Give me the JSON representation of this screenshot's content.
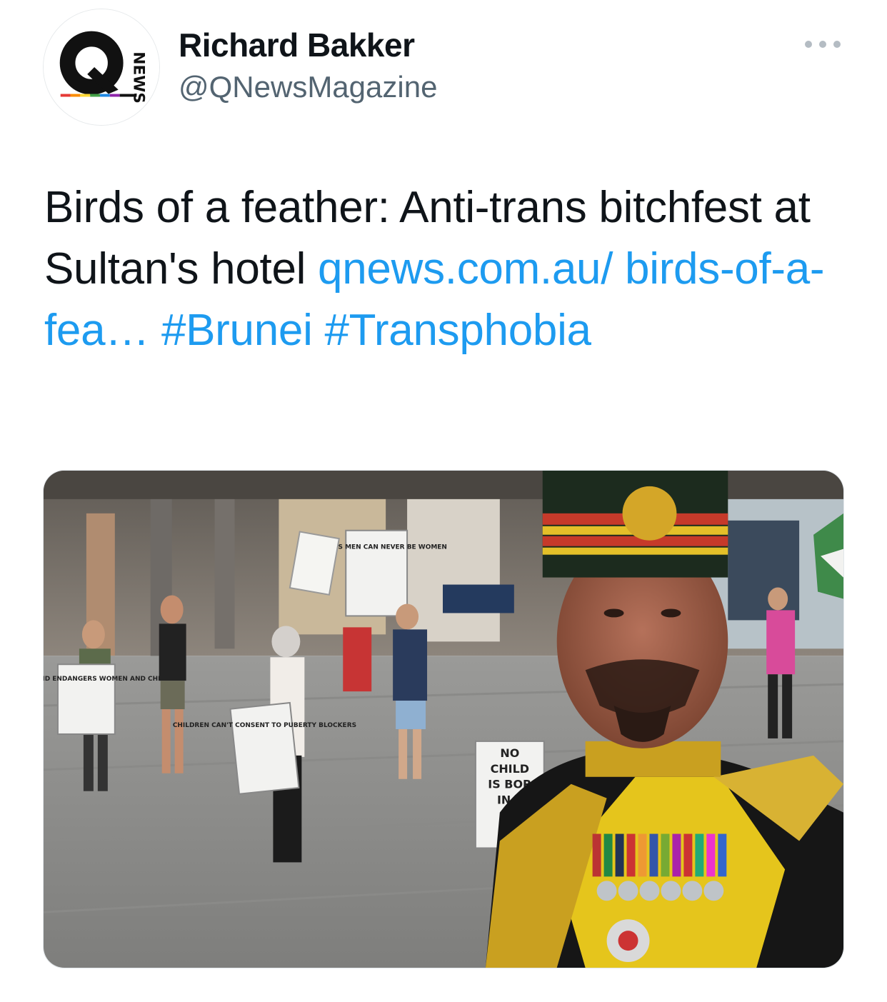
{
  "author": {
    "name": "Richard Bakker",
    "handle": "@QNewsMagazine",
    "avatar": {
      "letter": "Q",
      "side_text": "NEWS",
      "colors": [
        "#e53935",
        "#fb8c00",
        "#fdd835",
        "#43a047",
        "#1e88e5",
        "#8e24aa",
        "#111111"
      ]
    }
  },
  "menu": {
    "icon": "more-horizontal-icon"
  },
  "tweet": {
    "text_plain": "Birds of a feather: Anti-trans bitchfest at Sultan's hotel",
    "link_text": "qnews.com.au/ birds-of-a-fea…",
    "hashtag_1": "#Brunei",
    "hashtag_2": "#Transphobia"
  },
  "media": {
    "signs": {
      "sign_1": "OLD GUYS MEN CAN NEVER BE WOMEN",
      "sign_2": "OLD GUY SELF ID ENDANGERS WOMEN AND CHILDREN",
      "sign_3": "CHILDREN CAN'T CONSENT TO PUBERTY BLOCKERS",
      "sign_4_line_1": "NO",
      "sign_4_line_2": "CHILD",
      "sign_4_line_3": "IS BOR",
      "sign_4_line_4": "IN T"
    }
  },
  "colors": {
    "link": "#1d9bf0",
    "text": "#0f1419",
    "secondary": "#536471"
  }
}
